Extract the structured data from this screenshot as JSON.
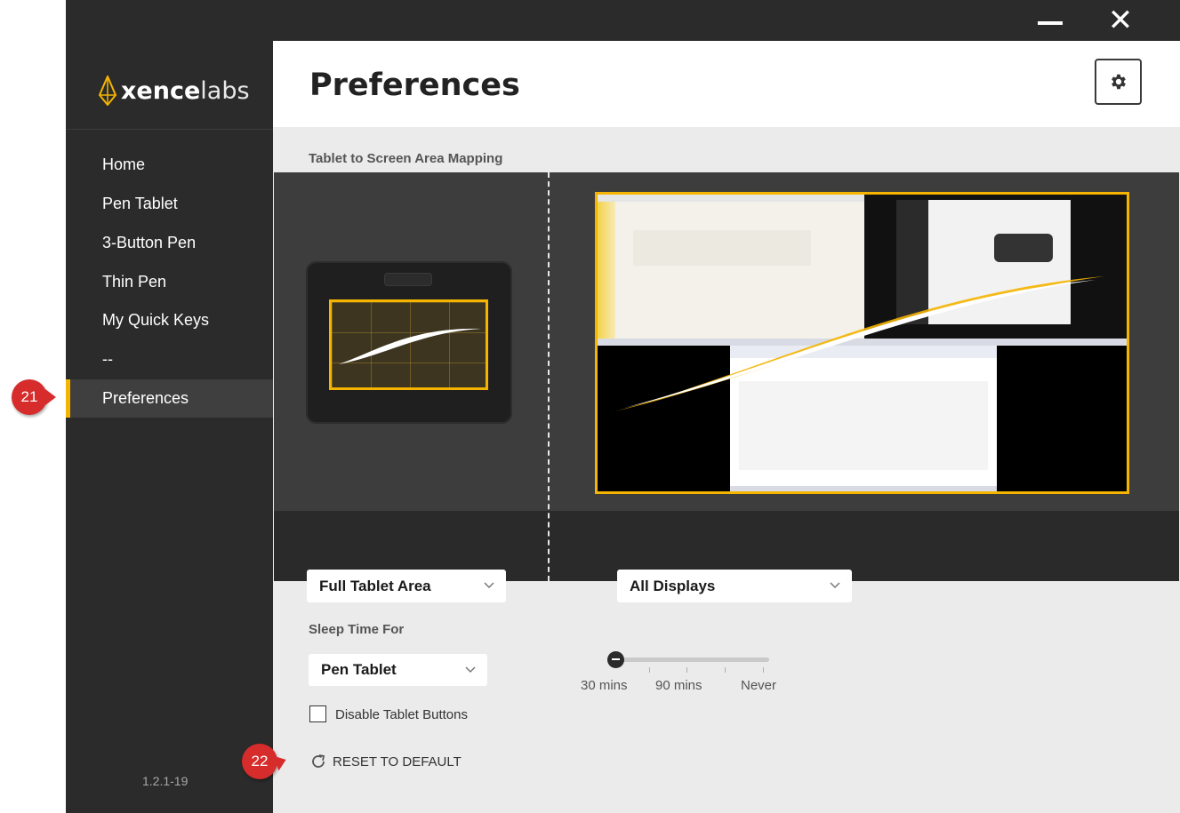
{
  "window": {
    "minimize_icon": "minimize-icon",
    "close_icon": "close-icon"
  },
  "brand": {
    "logo_bold": "xence",
    "logo_light": "labs",
    "logo_color": "#f5b400"
  },
  "sidebar": {
    "items": [
      {
        "label": "Home"
      },
      {
        "label": "Pen Tablet"
      },
      {
        "label": "3-Button Pen"
      },
      {
        "label": "Thin Pen"
      },
      {
        "label": "My Quick Keys"
      },
      {
        "label": "--"
      },
      {
        "label": "Preferences",
        "active": true
      }
    ],
    "version": "1.2.1-19",
    "accent_color": "#f5b400"
  },
  "main": {
    "title": "Preferences",
    "settings_icon": "gear-icon",
    "mapping": {
      "label": "Tablet to Screen Area Mapping",
      "tablet_area_value": "Full Tablet Area",
      "display_value": "All Displays"
    },
    "sleep": {
      "label": "Sleep Time For",
      "device_value": "Pen Tablet",
      "slider_labels": [
        "30 mins",
        "90 mins",
        "Never"
      ],
      "slider_position": 0
    },
    "disable_buttons": {
      "label": "Disable Tablet Buttons",
      "checked": false
    },
    "reset_label": "RESET TO DEFAULT"
  },
  "callouts": [
    "21",
    "22"
  ],
  "callout_color": "#d62c2c"
}
